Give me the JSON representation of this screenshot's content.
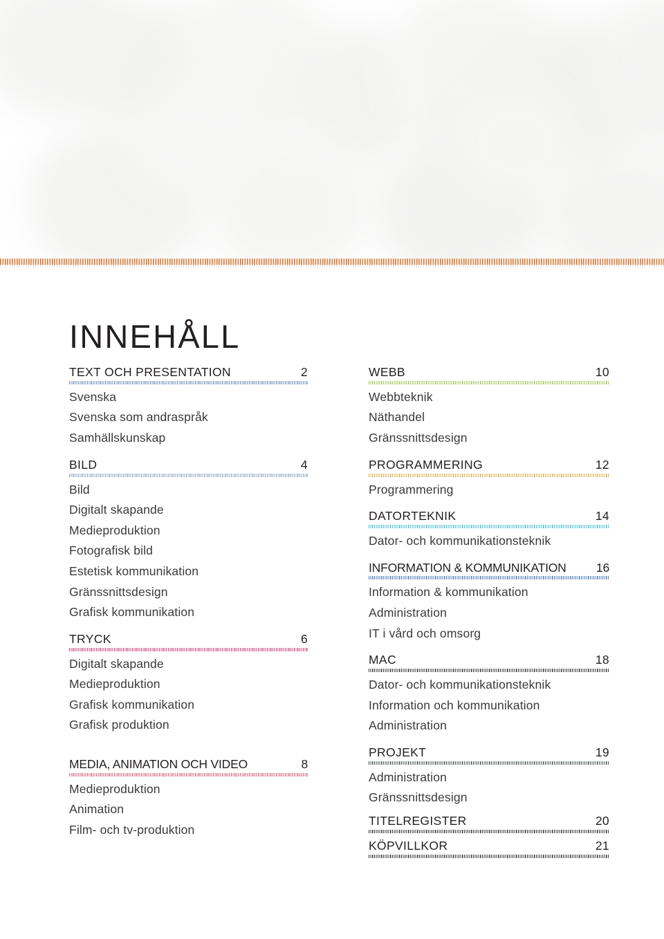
{
  "page": {
    "title": "INNEHÅLL",
    "background_color": "#ffffff",
    "top_rule_color": "#c97a3d"
  },
  "columns": {
    "left": [
      {
        "heading": "TEXT OCH PRESENTATION",
        "page": "2",
        "rule_color": "#6e90b4",
        "items": [
          "Svenska",
          "Svenska som andraspråk",
          "Samhällskunskap"
        ]
      },
      {
        "heading": "BILD",
        "page": "4",
        "rule_color": "#8fa4bd",
        "items": [
          "Bild",
          "Digitalt skapande",
          "Medieproduktion",
          "Fotografisk bild",
          "Estetisk kommunikation",
          "Gränssnittsdesign",
          "Grafisk kommunikation"
        ]
      },
      {
        "heading": "TRYCK",
        "page": "6",
        "rule_color": "#c7447f",
        "items": [
          "Digitalt skapande",
          "Medieproduktion",
          "Grafisk kommunikation",
          "Grafisk produktion"
        ]
      },
      {
        "heading": "MEDIA, ANIMATION OCH VIDEO",
        "page": "8",
        "rule_color": "#d4607e",
        "items": [
          "Medieproduktion",
          "Animation",
          "Film- och tv-produktion"
        ]
      }
    ],
    "right": [
      {
        "heading": "WEBB",
        "page": "10",
        "rule_color": "#a9c45c",
        "items": [
          "Webbteknik",
          "Näthandel",
          "Gränssnittsdesign"
        ]
      },
      {
        "heading": "PROGRAMMERING",
        "page": "12",
        "rule_color": "#d8b452",
        "items": [
          "Programmering"
        ]
      },
      {
        "heading": "DATORTEKNIK",
        "page": "14",
        "rule_color": "#4cbfd6",
        "items": [
          "Dator- och kommunikationsteknik"
        ]
      },
      {
        "heading": "INFORMATION & KOMMUNIKATION",
        "page": "16",
        "rule_color": "#4e7fb5",
        "items": [
          "Information & kommunikation",
          "Administration",
          "IT i vård och omsorg"
        ]
      },
      {
        "heading": "MAC",
        "page": "18",
        "rule_color": "#3b3b3b",
        "items": [
          "Dator- och kommunikationsteknik",
          "Information och kommunikation",
          "Administration"
        ]
      },
      {
        "heading": "PROJEKT",
        "page": "19",
        "rule_color": "#4a5a52",
        "items": [
          "Administration",
          "Gränssnittsdesign"
        ]
      },
      {
        "heading": "TITELREGISTER",
        "page": "20",
        "rule_color": "#3b3b3b",
        "items": []
      },
      {
        "heading": "KÖPVILLKOR",
        "page": "21",
        "rule_color": "#3b3b3b",
        "items": []
      }
    ]
  }
}
